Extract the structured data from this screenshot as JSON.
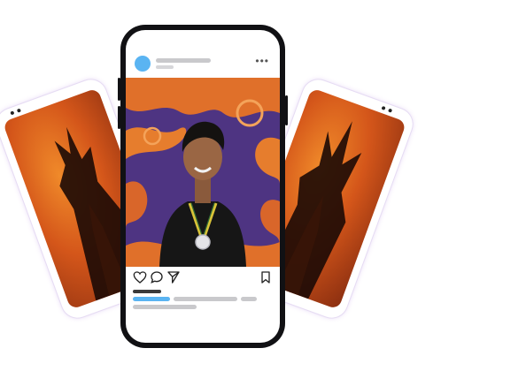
{
  "post": {
    "more_icon": "more-horizontal-icon",
    "action_icons": [
      "heart-icon",
      "comment-icon",
      "send-icon",
      "bookmark-icon"
    ]
  },
  "colors": {
    "avatar": "#5ab4f2",
    "accent_bar": "#5ab4f2",
    "placeholder_bar": "#c9c9cc",
    "phone_frame": "#111114",
    "back_screen_orange": "#e0702a",
    "photo_background_purple": "#5b3a8c"
  }
}
